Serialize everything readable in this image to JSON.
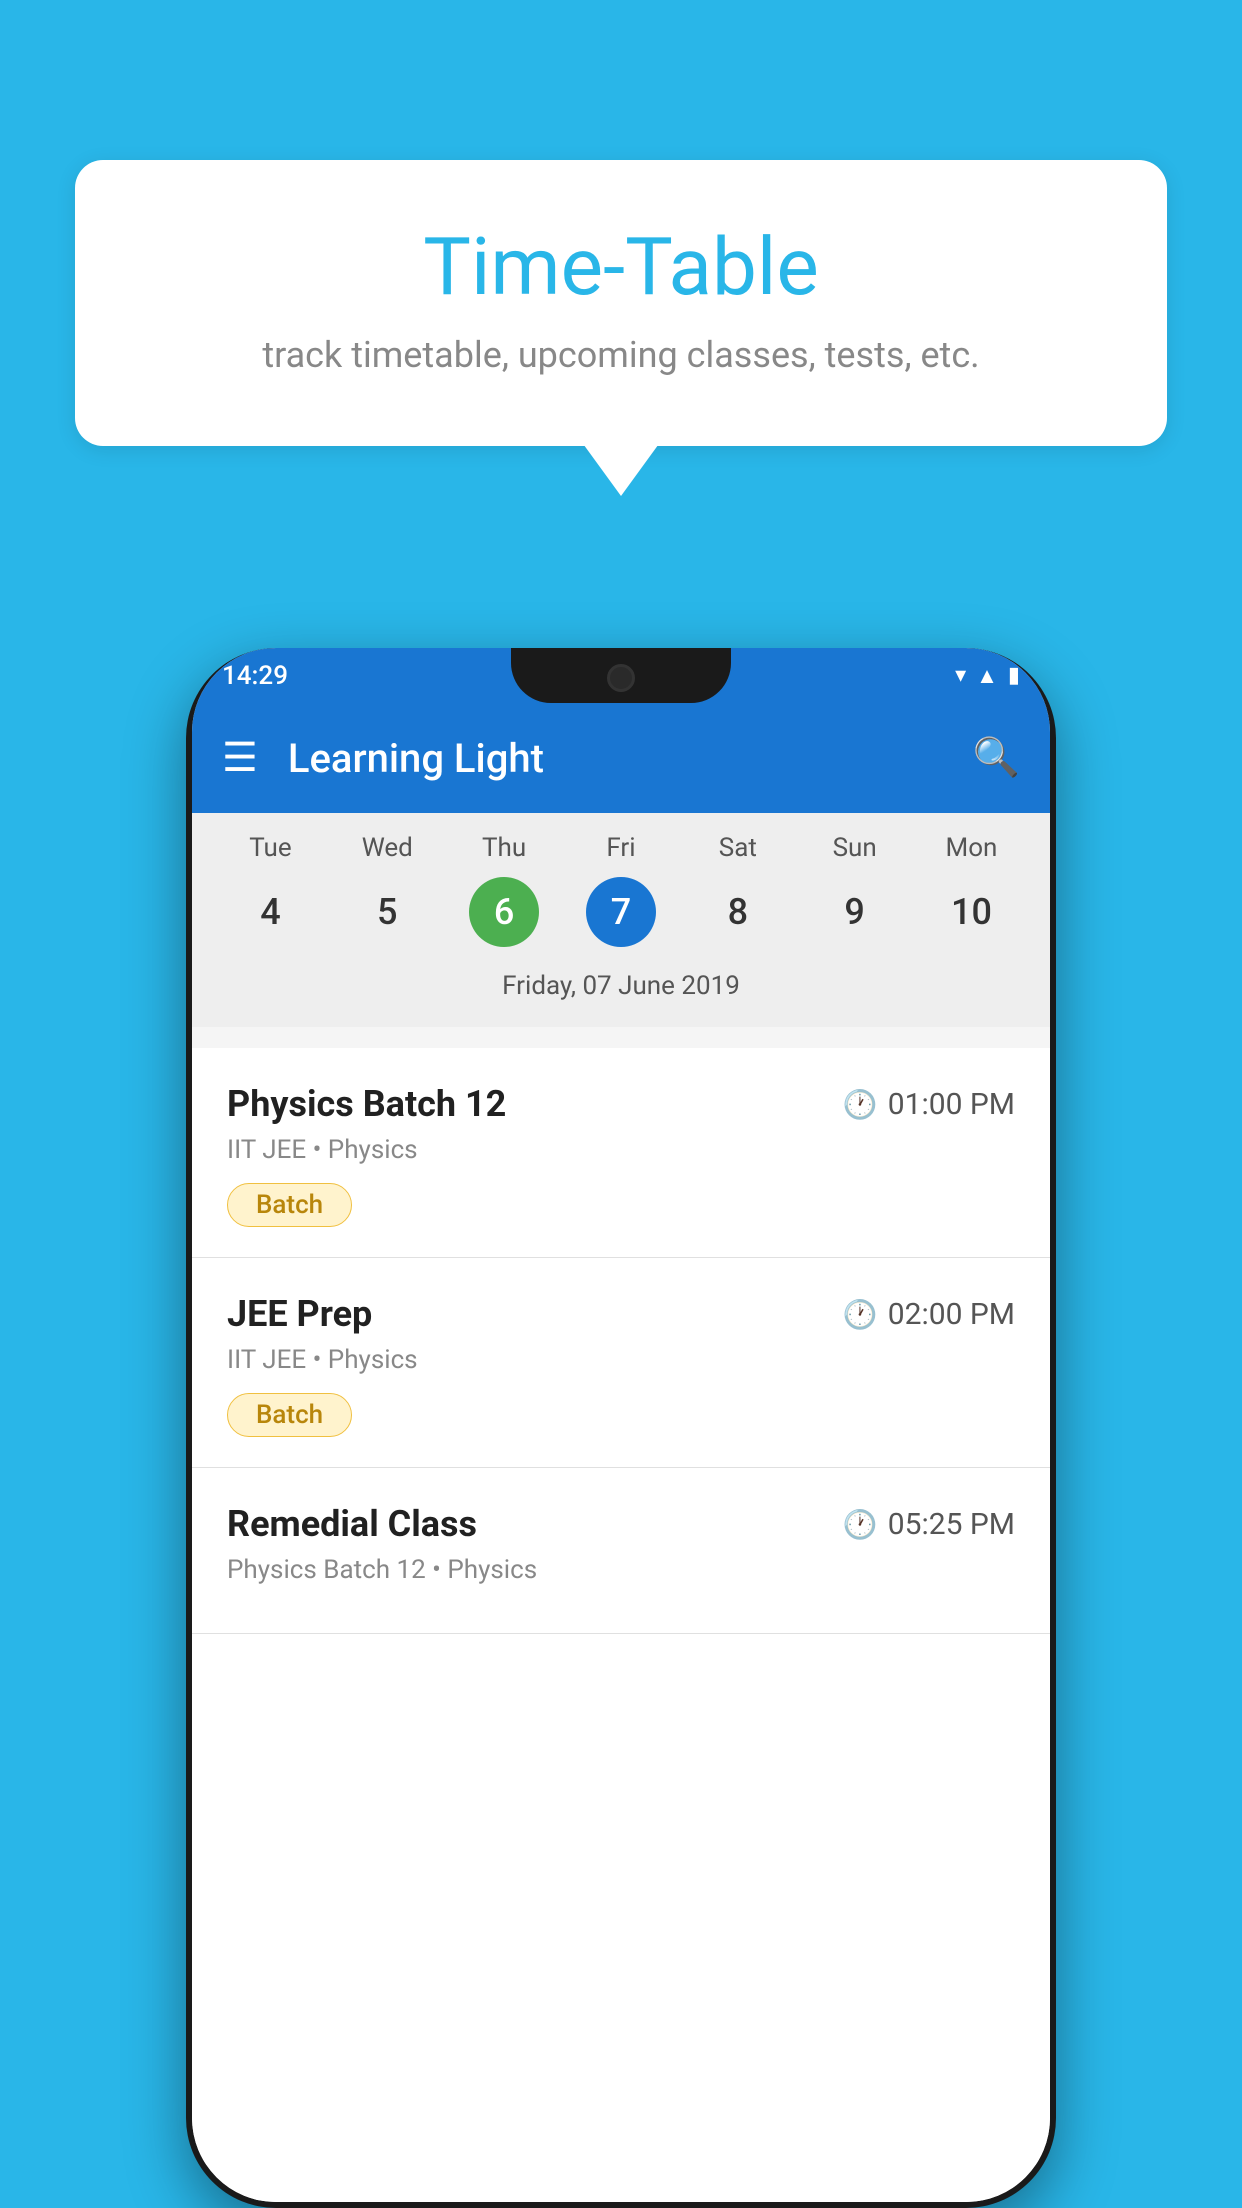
{
  "page": {
    "background_color": "#29b6e8"
  },
  "speech_bubble": {
    "title": "Time-Table",
    "subtitle": "track timetable, upcoming classes, tests, etc."
  },
  "app_bar": {
    "title": "Learning Light",
    "hamburger_label": "☰",
    "search_label": "🔍"
  },
  "status_bar": {
    "time": "14:29"
  },
  "calendar": {
    "days": [
      {
        "name": "Tue",
        "number": "4",
        "state": "normal"
      },
      {
        "name": "Wed",
        "number": "5",
        "state": "normal"
      },
      {
        "name": "Thu",
        "number": "6",
        "state": "today"
      },
      {
        "name": "Fri",
        "number": "7",
        "state": "selected"
      },
      {
        "name": "Sat",
        "number": "8",
        "state": "normal"
      },
      {
        "name": "Sun",
        "number": "9",
        "state": "normal"
      },
      {
        "name": "Mon",
        "number": "10",
        "state": "normal"
      }
    ],
    "selected_date_label": "Friday, 07 June 2019"
  },
  "schedule": {
    "items": [
      {
        "name": "Physics Batch 12",
        "time": "01:00 PM",
        "sub": "IIT JEE • Physics",
        "tag": "Batch"
      },
      {
        "name": "JEE Prep",
        "time": "02:00 PM",
        "sub": "IIT JEE • Physics",
        "tag": "Batch"
      },
      {
        "name": "Remedial Class",
        "time": "05:25 PM",
        "sub": "Physics Batch 12 • Physics",
        "tag": null
      }
    ]
  }
}
